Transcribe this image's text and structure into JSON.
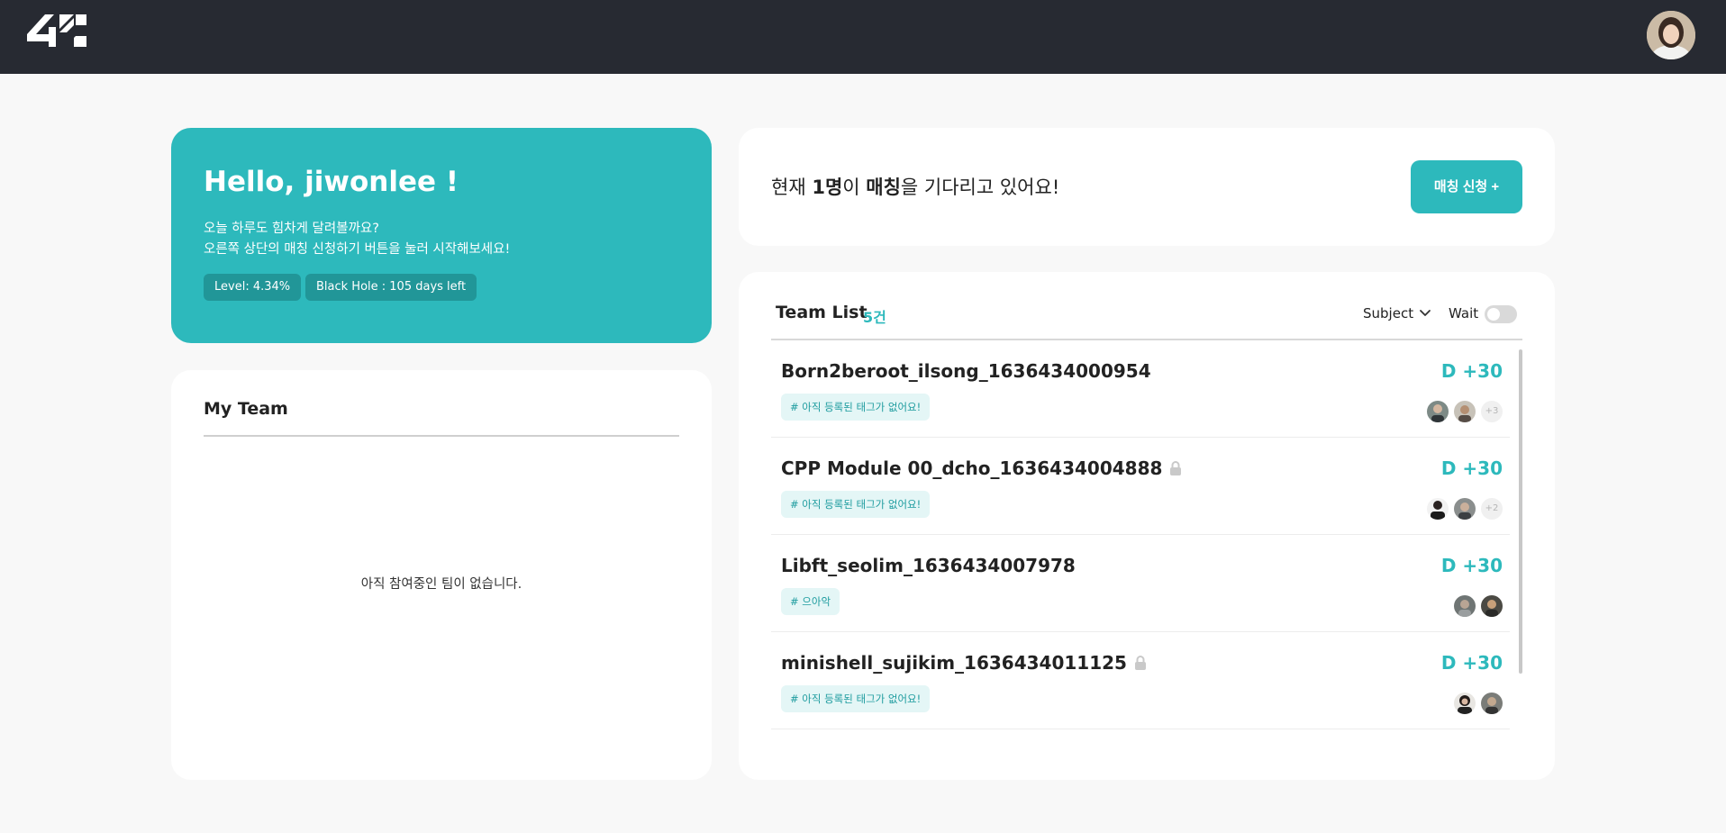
{
  "header": {
    "logo_icon": "42-logo-icon",
    "avatar_icon": "user-avatar-icon"
  },
  "greeting": {
    "title": "Hello, jiwonlee !",
    "line1": "오늘 하루도 힘차게 달려볼까요?",
    "line2": "오른쪽 상단의 매칭 신청하기 버튼을 눌러 시작해보세요!",
    "level": "Level: 4.34%",
    "blackhole": "Black Hole : 105 days left",
    "bg_color": "#2db9bc"
  },
  "my_team": {
    "title": "My Team",
    "empty_text": "아직 참여중인 팀이 없습니다."
  },
  "waiting": {
    "prefix": "현재 ",
    "count": "1명",
    "mid": "이 ",
    "word": "매칭",
    "suffix": "을 기다리고 있어요!",
    "button": "매칭 신청 +"
  },
  "team_list": {
    "title": "Team List",
    "count": "5건",
    "subject_label": "Subject",
    "wait_label": "Wait",
    "wait_toggle_on": false,
    "rows": [
      {
        "name": "Born2beroot_ilsong_1636434000954",
        "locked": false,
        "tag": "# 아직 등록된 태그가 없어요!",
        "dday": "D +30",
        "more": "+3"
      },
      {
        "name": "CPP Module 00_dcho_1636434004888",
        "locked": true,
        "tag": "# 아직 등록된 태그가 없어요!",
        "dday": "D +30",
        "more": "+2"
      },
      {
        "name": "Libft_seolim_1636434007978",
        "locked": false,
        "tag": "# 으아악",
        "dday": "D +30",
        "more": ""
      },
      {
        "name": "minishell_sujikim_1636434011125",
        "locked": true,
        "tag": "# 아직 등록된 태그가 없어요!",
        "dday": "D +30",
        "more": ""
      }
    ]
  },
  "colors": {
    "accent": "#2db9bc",
    "topbar": "#272a32",
    "background": "#f8f8f8"
  }
}
